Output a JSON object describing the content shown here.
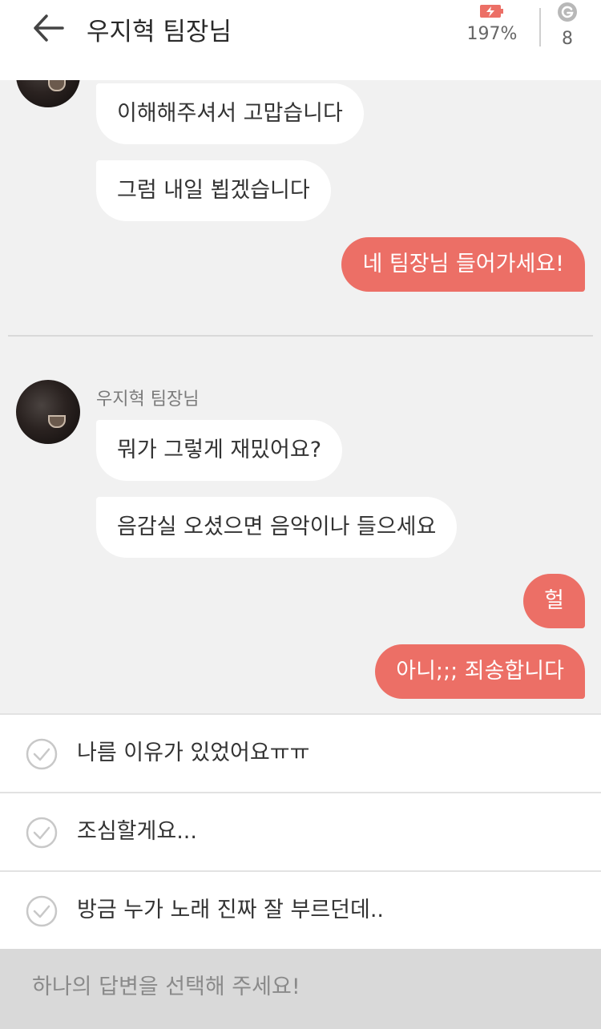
{
  "header": {
    "title": "우지혁 팀장님",
    "battery_percent": "197%",
    "gcoin_count": "8"
  },
  "chat": {
    "sender_name": "우지혁 팀장님",
    "messages": [
      {
        "from": "them",
        "text": "이해해주셔서 고맙습니다"
      },
      {
        "from": "them",
        "text": "그럼 내일 뵙겠습니다"
      },
      {
        "from": "me",
        "text": "네 팀장님 들어가세요!"
      },
      {
        "from": "them",
        "text": "뭐가 그렇게 재밌어요?"
      },
      {
        "from": "them",
        "text": "음감실 오셨으면 음악이나 들으세요"
      },
      {
        "from": "me",
        "text": "헐"
      },
      {
        "from": "me",
        "text": "아니;;; 죄송합니다"
      }
    ]
  },
  "choices": [
    {
      "label": "나름 이유가 있었어요ㅠㅠ"
    },
    {
      "label": "조심할게요..."
    },
    {
      "label": "방금 누가 노래 진짜 잘 부르던데.."
    }
  ],
  "prompt": "하나의 답변을 선택해 주세요!",
  "colors": {
    "accent": "#ec6f66",
    "chat_bg": "#f1f1f1",
    "bubble_in": "#ffffff"
  }
}
